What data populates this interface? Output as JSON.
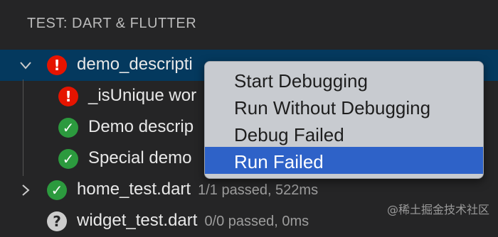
{
  "header": {
    "title": "TEST: DART & FLUTTER"
  },
  "tree": {
    "rows": [
      {
        "label": "demo_descripti",
        "desc": ""
      },
      {
        "label": "_isUnique wor",
        "desc": ""
      },
      {
        "label": "Demo descrip",
        "desc": ""
      },
      {
        "label": "Special demo",
        "desc": ""
      },
      {
        "label": "home_test.dart",
        "desc": "1/1 passed, 522ms"
      },
      {
        "label": "widget_test.dart",
        "desc": "0/0 passed, 0ms"
      }
    ]
  },
  "context_menu": {
    "items": [
      {
        "label": "Start Debugging"
      },
      {
        "label": "Run Without Debugging"
      },
      {
        "label": "Debug Failed"
      },
      {
        "label": "Run Failed"
      }
    ],
    "highlighted_index": 3
  },
  "watermark": "@稀土掘金技术社区",
  "colors": {
    "fail": "#e51400",
    "pass": "#2c9a3e",
    "selection": "#04395e",
    "menu_highlight": "#2e62c8"
  }
}
